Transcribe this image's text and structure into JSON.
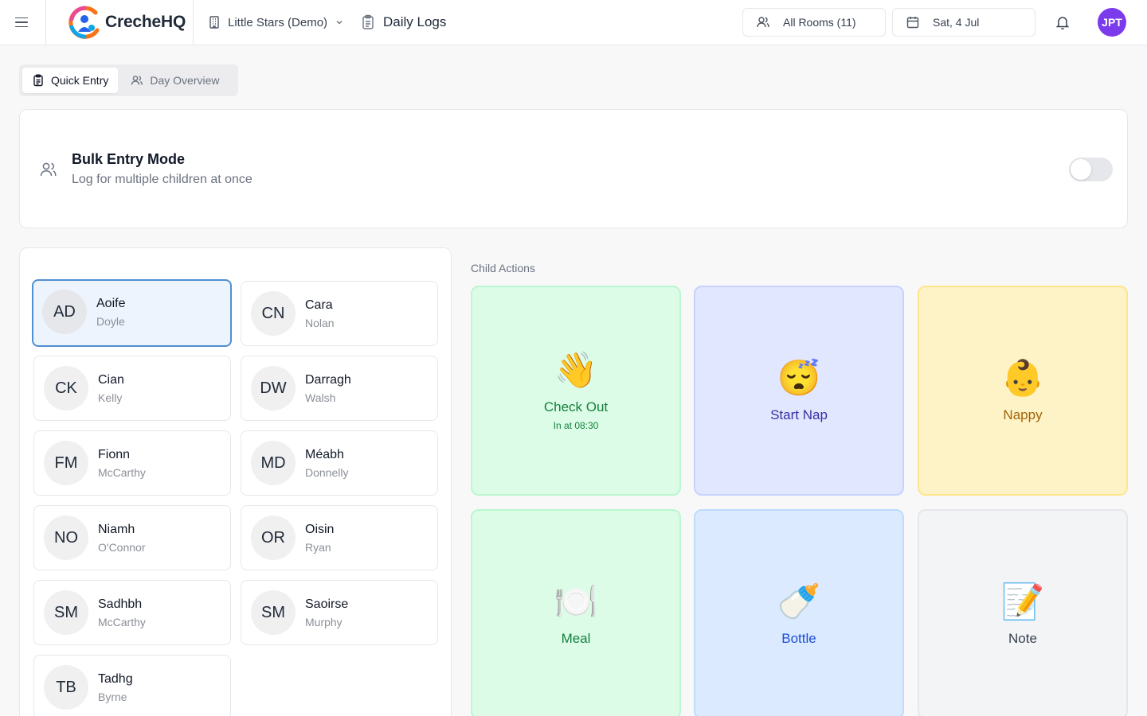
{
  "header": {
    "app_name": "CrecheHQ",
    "org_name": "Little Stars (Demo)",
    "section": "Daily Logs",
    "rooms_label": "All Rooms (11)",
    "date_label": "Sat, 4 Jul",
    "user_initials": "JPT"
  },
  "tabs": [
    {
      "label": "Quick Entry",
      "active": true
    },
    {
      "label": "Day Overview",
      "active": false
    }
  ],
  "bulk": {
    "title": "Bulk Entry Mode",
    "subtitle": "Log for multiple children at once",
    "enabled": false
  },
  "children": [
    {
      "initials": "AD",
      "first": "Aoife",
      "last": "Doyle",
      "selected": true
    },
    {
      "initials": "CN",
      "first": "Cara",
      "last": "Nolan",
      "selected": false
    },
    {
      "initials": "CK",
      "first": "Cian",
      "last": "Kelly",
      "selected": false
    },
    {
      "initials": "DW",
      "first": "Darragh",
      "last": "Walsh",
      "selected": false
    },
    {
      "initials": "FM",
      "first": "Fionn",
      "last": "McCarthy",
      "selected": false
    },
    {
      "initials": "MD",
      "first": "Méabh",
      "last": "Donnelly",
      "selected": false
    },
    {
      "initials": "NO",
      "first": "Niamh",
      "last": "O'Connor",
      "selected": false
    },
    {
      "initials": "OR",
      "first": "Oisin",
      "last": "Ryan",
      "selected": false
    },
    {
      "initials": "SM",
      "first": "Sadhbh",
      "last": "McCarthy",
      "selected": false
    },
    {
      "initials": "SM",
      "first": "Saoirse",
      "last": "Murphy",
      "selected": false
    },
    {
      "initials": "TB",
      "first": "Tadhg",
      "last": "Byrne",
      "selected": false
    }
  ],
  "actions_label": "Child Actions",
  "actions": [
    {
      "icon": "waving-hand-icon",
      "emoji": "👋",
      "label": "Check Out",
      "sub": "In at 08:30",
      "color": "#15803d"
    },
    {
      "icon": "sleeping-face-icon",
      "emoji": "😴",
      "label": "Start Nap",
      "color": "#3730a3"
    },
    {
      "icon": "baby-face-icon",
      "emoji": "👶",
      "label": "Nappy",
      "color": "#a16207"
    },
    {
      "icon": "plate-cutlery-icon",
      "emoji": "🍽️",
      "label": "Meal",
      "color": "#15803d"
    },
    {
      "icon": "baby-bottle-icon",
      "emoji": "🍼",
      "label": "Bottle",
      "color": "#1d4ed8"
    },
    {
      "icon": "memo-pencil-icon",
      "emoji": "📝",
      "label": "Note",
      "color": "#374151"
    }
  ],
  "colors": {
    "accent_avatar": "#7c3aed",
    "selected_border": "#4f8fd2",
    "selected_bg": "#eef4fd"
  }
}
